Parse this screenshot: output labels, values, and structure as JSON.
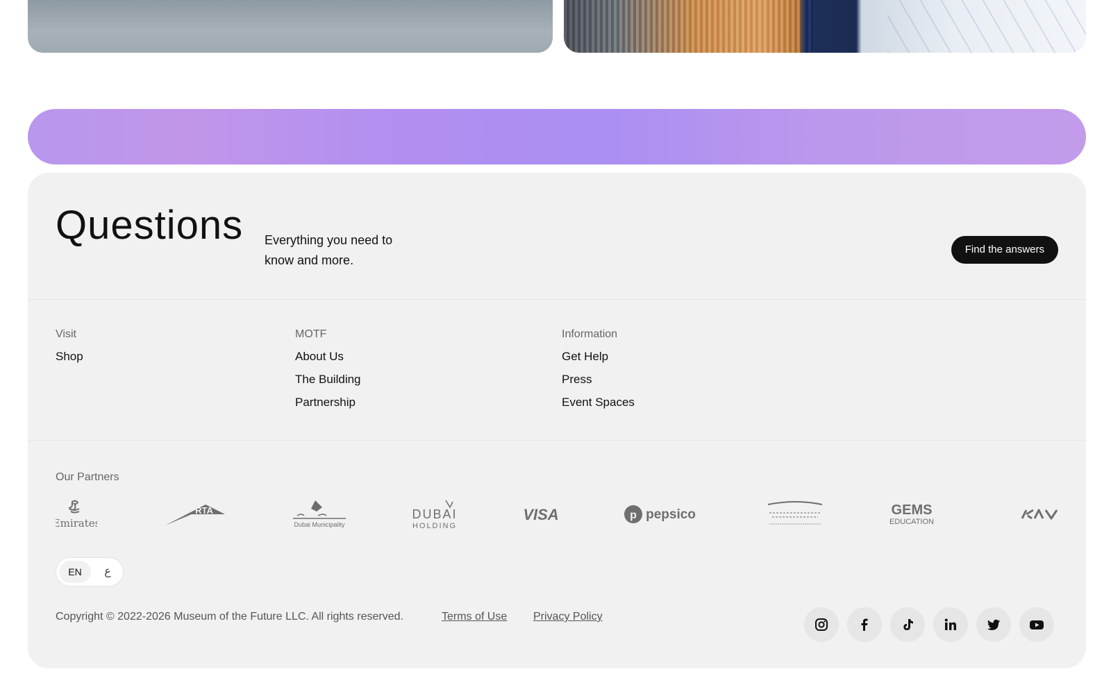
{
  "questions": {
    "title": "Questions",
    "description": "Everything you need to know and more.",
    "cta_label": "Find the answers"
  },
  "nav": {
    "visit": {
      "heading": "Visit",
      "links": [
        "Shop"
      ]
    },
    "motf": {
      "heading": "MOTF",
      "links": [
        "About Us",
        "The Building",
        "Partnership"
      ]
    },
    "information": {
      "heading": "Information",
      "links": [
        "Get Help",
        "Press",
        "Event Spaces"
      ]
    }
  },
  "partners": {
    "heading": "Our Partners",
    "logos": [
      {
        "name": "emirates-logo",
        "text": "Emirates"
      },
      {
        "name": "rta-logo",
        "text": "RTA"
      },
      {
        "name": "dubai-municipality-logo",
        "text": "Dubai Municipality"
      },
      {
        "name": "dubai-holding-logo",
        "text": "DUBAI",
        "text2": "HOLDING"
      },
      {
        "name": "visa-logo",
        "text": "VISA"
      },
      {
        "name": "pepsico-logo",
        "text": "pepsico"
      },
      {
        "name": "mbrsc-logo",
        "text": ""
      },
      {
        "name": "gems-logo",
        "text": "GEMS",
        "text2": "EDUCATION"
      },
      {
        "name": "kia-logo",
        "text": "KIA"
      }
    ]
  },
  "language": {
    "en": "EN",
    "ar": "ع"
  },
  "legal": {
    "copyright": "Copyright © 2022-2026 Museum of the Future LLC. All rights reserved.",
    "terms": "Terms of Use",
    "privacy": "Privacy Policy"
  },
  "socials": [
    "instagram-icon",
    "facebook-icon",
    "tiktok-icon",
    "linkedin-icon",
    "twitter-icon",
    "youtube-icon"
  ],
  "colors": {
    "band": "#b18ff0",
    "footer_bg": "#f1f1f1",
    "button_bg": "#111111"
  }
}
